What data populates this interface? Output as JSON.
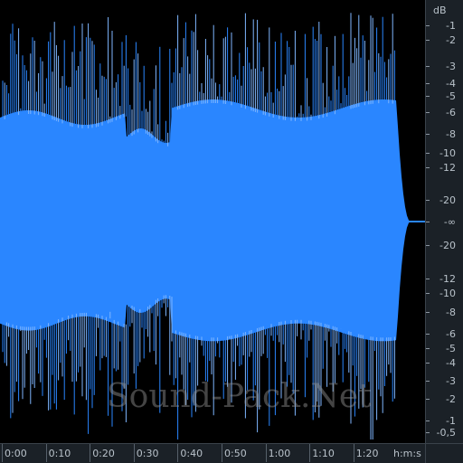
{
  "colors": {
    "waveform_fill": "#2a86ff",
    "waveform_peak": "#7fb6ff",
    "background": "#000000",
    "ruler_bg": "#1b2127",
    "ruler_text": "#b9c2ca"
  },
  "db_scale": {
    "unit": "dB",
    "labels": [
      "-1",
      "-2",
      "-3",
      "-4",
      "-5",
      "-6",
      "-8",
      "-10",
      "-12",
      "-20",
      "-∞",
      "-20",
      "-12",
      "-10",
      "-8",
      "-6",
      "-5",
      "-4",
      "-3",
      "-2",
      "-1",
      "-0,5"
    ]
  },
  "time_ruler": {
    "unit": "h:m:s",
    "labels": [
      "0:00",
      "0:10",
      "0:20",
      "0:30",
      "0:40",
      "0:50",
      "1:00",
      "1:10",
      "1:20"
    ]
  },
  "watermark": "Sound-Pack.Net"
}
